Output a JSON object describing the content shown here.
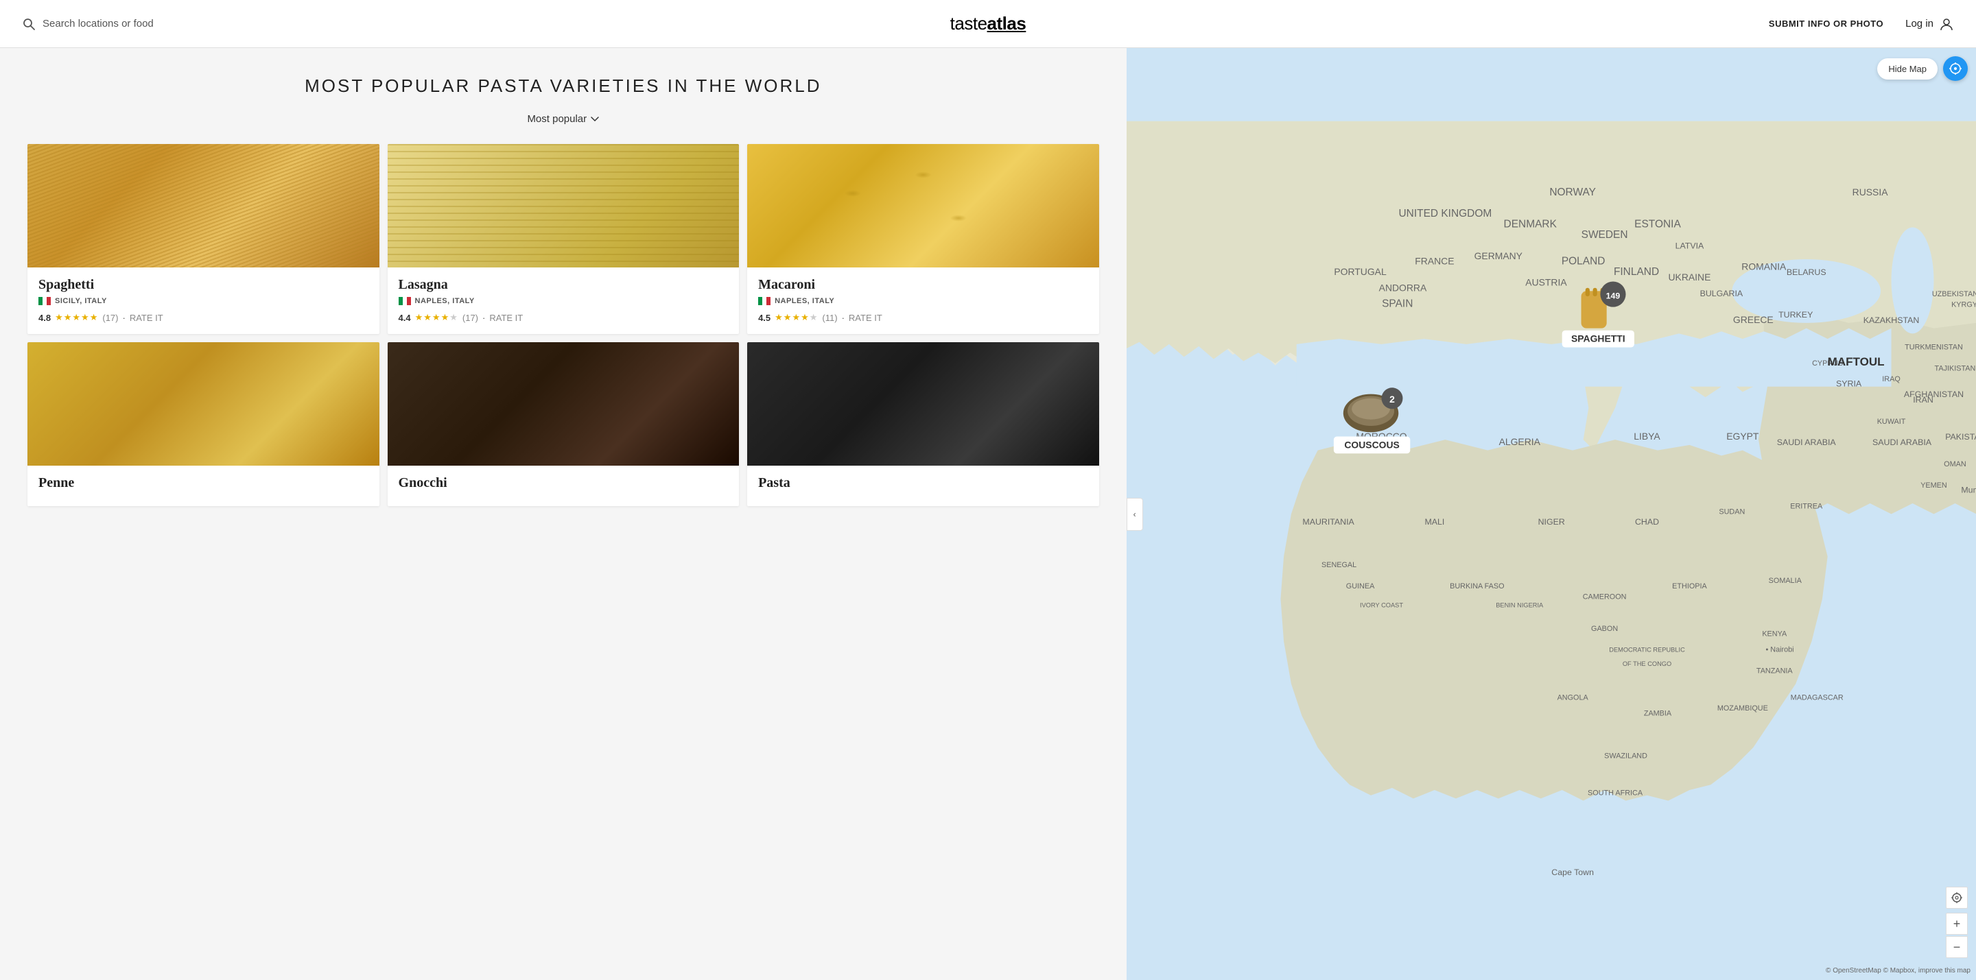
{
  "header": {
    "search_placeholder": "Search locations or food",
    "logo_text1": "taste",
    "logo_text2": "atlas",
    "submit_label": "SUBMIT INFO OR PHOTO",
    "login_label": "Log in"
  },
  "page": {
    "title": "MOST POPULAR PASTA VARIETIES IN THE WORLD",
    "sort_label": "Most popular"
  },
  "foods": [
    {
      "id": "spaghetti",
      "name": "Spaghetti",
      "origin": "SICILY, ITALY",
      "rating": "4.8",
      "stars": 5,
      "half_star": false,
      "review_count": "17",
      "img_type": "spaghetti"
    },
    {
      "id": "lasagna",
      "name": "Lasagna",
      "origin": "NAPLES, ITALY",
      "rating": "4.4",
      "stars": 4,
      "half_star": true,
      "review_count": "17",
      "img_type": "lasagna"
    },
    {
      "id": "macaroni",
      "name": "Macaroni",
      "origin": "NAPLES, ITALY",
      "rating": "4.5",
      "stars": 4,
      "half_star": true,
      "review_count": "11",
      "img_type": "macaroni"
    },
    {
      "id": "penne",
      "name": "Penne",
      "origin": "",
      "rating": "",
      "stars": 0,
      "half_star": false,
      "review_count": "",
      "img_type": "penne"
    },
    {
      "id": "gnocchi",
      "name": "Gnocchi",
      "origin": "",
      "rating": "",
      "stars": 0,
      "half_star": false,
      "review_count": "",
      "img_type": "gnocchi"
    },
    {
      "id": "pasta6",
      "name": "Pasta",
      "origin": "",
      "rating": "",
      "stars": 0,
      "half_star": false,
      "review_count": "",
      "img_type": "pasta"
    }
  ],
  "map": {
    "hide_label": "Hide Map",
    "pins": [
      {
        "id": "spaghetti-pin",
        "label": "SPAGHETTI",
        "badge": "149",
        "type": "pasta-icon"
      },
      {
        "id": "couscous-pin",
        "label": "COUSCOUS",
        "badge": "2",
        "type": "bowl-icon"
      },
      {
        "id": "maftoul-pin",
        "label": "MAFTOUL",
        "badge": null,
        "type": "text-only"
      }
    ],
    "attribution": "© OpenStreetMap © Mapbox, improve this map"
  },
  "rate_it_label": "RATE IT"
}
